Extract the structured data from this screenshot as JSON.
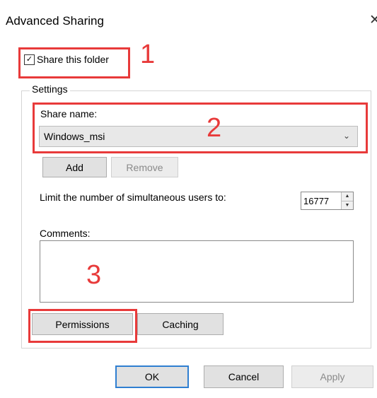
{
  "dialog": {
    "title": "Advanced Sharing",
    "close_glyph": "✕"
  },
  "share_folder": {
    "label": "Share this folder",
    "checked": true,
    "check_glyph": "✓"
  },
  "settings": {
    "group_label": "Settings",
    "share_name_label": "Share name:",
    "share_name_value": "Windows_msi",
    "add_label": "Add",
    "remove_label": "Remove",
    "limit_label": "Limit the number of simultaneous users to:",
    "limit_value": "16777",
    "comments_label": "Comments:",
    "comments_value": "",
    "permissions_label": "Permissions",
    "caching_label": "Caching"
  },
  "footer": {
    "ok_label": "OK",
    "cancel_label": "Cancel",
    "apply_label": "Apply"
  },
  "annotations": {
    "n1": "1",
    "n2": "2",
    "n3": "3",
    "color": "#e83a3a"
  },
  "icons": {
    "dropdown": "chevron-down-icon",
    "spin_up": "arrow-up-icon",
    "spin_down": "arrow-down-icon"
  }
}
